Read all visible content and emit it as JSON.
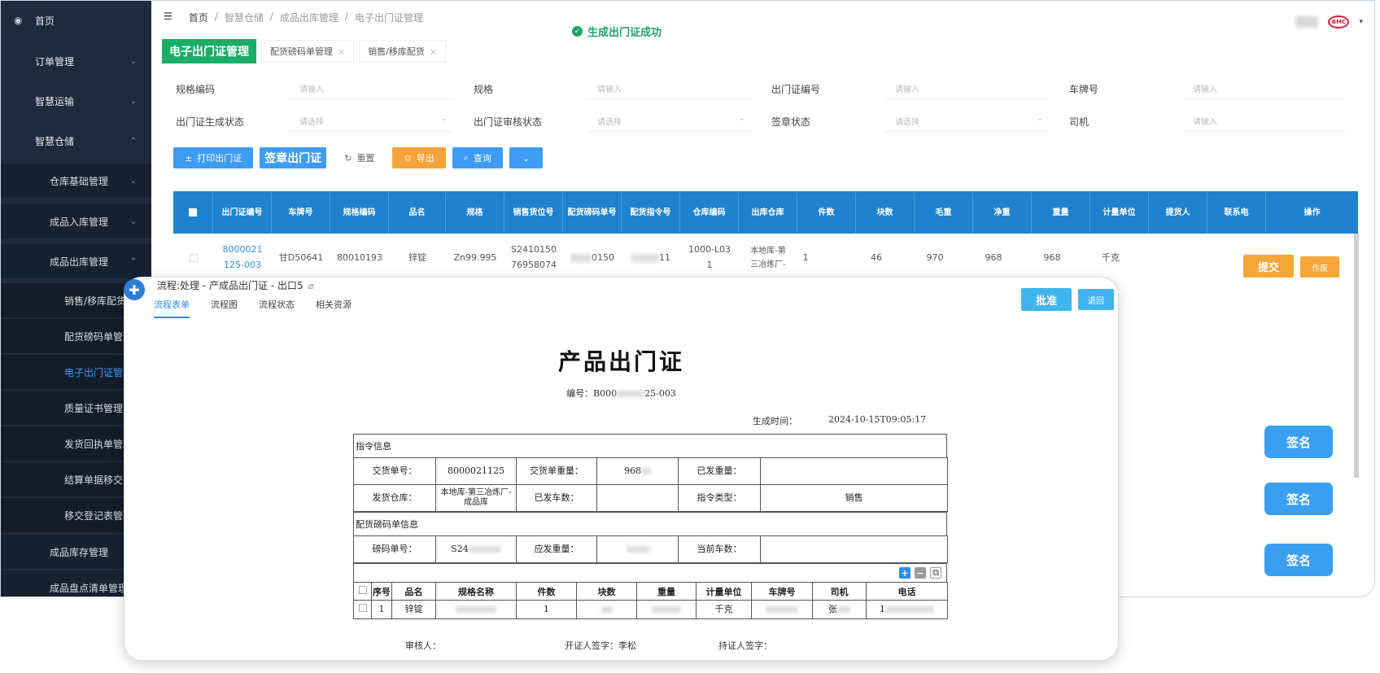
{
  "sidebar": {
    "items": [
      {
        "label": "首页",
        "level": 1,
        "expanded": false,
        "chevron": false
      },
      {
        "label": "订单管理",
        "level": 1,
        "chevron": "down"
      },
      {
        "label": "智慧运输",
        "level": 1,
        "chevron": "down"
      },
      {
        "label": "智慧仓储",
        "level": 1,
        "chevron": "up"
      },
      {
        "label": "仓库基础管理",
        "level": 2,
        "chevron": "down"
      },
      {
        "label": "成品入库管理",
        "level": 2,
        "chevron": "down"
      },
      {
        "label": "成品出库管理",
        "level": 2,
        "chevron": "up"
      },
      {
        "label": "销售/移库配货",
        "level": 3
      },
      {
        "label": "配货磅码单管理",
        "level": 3
      },
      {
        "label": "电子出门证管理",
        "level": 3,
        "active": true
      },
      {
        "label": "质量证书管理",
        "level": 3
      },
      {
        "label": "发货回执单管理",
        "level": 3
      },
      {
        "label": "结算单据移交",
        "level": 3
      },
      {
        "label": "移交登记表管理",
        "level": 3
      },
      {
        "label": "成品库存管理",
        "level": 2
      },
      {
        "label": "成品盘点清单管理",
        "level": 2
      }
    ]
  },
  "breadcrumb": [
    "首页",
    "智慧仓储",
    "成品出库管理",
    "电子出门证管理"
  ],
  "toast": "生成出门证成功",
  "tabs": [
    {
      "label": "电子出门证管理",
      "active": true
    },
    {
      "label": "配货磅码单管理",
      "close": "×"
    },
    {
      "label": "销售/移库配货",
      "close": "×"
    }
  ],
  "filters": {
    "spec_code_label": "规格编码",
    "spec_code_placeholder": "请输入",
    "spec_label": "规格",
    "spec_placeholder": "请输入",
    "permit_no_label": "出门证编号",
    "permit_no_placeholder": "请输入",
    "plate_label": "车牌号",
    "plate_placeholder": "请输入",
    "gen_status_label": "出门证生成状态",
    "gen_status_placeholder": "请选择",
    "audit_status_label": "出门证审核状态",
    "audit_status_placeholder": "请选择",
    "seal_status_label": "签章状态",
    "seal_status_placeholder": "请选择",
    "driver_label": "司机",
    "driver_placeholder": "请输入"
  },
  "actions": {
    "print": "打印出门证",
    "seal": "签章出门证",
    "reset": "重置",
    "export": "导出",
    "query": "查询"
  },
  "grid": {
    "headers": [
      "出门证编号",
      "车牌号",
      "规格编码",
      "品名",
      "规格",
      "销售货位号",
      "配货磅码单号",
      "配货指令号",
      "仓库编码",
      "出库仓库",
      "件数",
      "块数",
      "毛重",
      "净重",
      "重量",
      "计量单位",
      "提货人",
      "联系电",
      "操作"
    ],
    "row": {
      "permit_no_1": "8000021",
      "permit_no_2": "125-003",
      "plate": "甘D50641",
      "spec_code": "80010193",
      "product": "锌锭",
      "spec": "Zn99.995",
      "sales_loc_1": "S2410150",
      "sales_loc_2": "76958074",
      "bill_no": "0150",
      "instr_no": "11",
      "wh_code_1": "1000-L03",
      "wh_code_2": "1",
      "warehouse_1": "本地库-第",
      "warehouse_2": "三冶炼厂-",
      "pieces": "1",
      "blocks": "46",
      "gross": "970",
      "net": "968",
      "weight": "968",
      "unit": "千克"
    },
    "ops": {
      "submit": "提交",
      "void": "作废"
    }
  },
  "sign_buttons": [
    "签名",
    "签名",
    "签名"
  ],
  "modal": {
    "title": "流程:处理 - 产成品出门证 - 出口5",
    "tabs": [
      "流程表单",
      "流程图",
      "流程状态",
      "相关资源"
    ],
    "approve": "批准",
    "return": "退回",
    "doc_title": "产品出门证",
    "doc_no": "编号：B000",
    "doc_no_tail": "25-003",
    "gen_time_label": "生成时间：",
    "gen_time": "2024-10-15T09:05:17",
    "section1": "指令信息",
    "s1": {
      "delivery_no_label": "交货单号：",
      "delivery_no": "8000021125",
      "delivery_weight_label": "交货单重量：",
      "delivery_weight": "968",
      "shipped_weight_label": "已发重量：",
      "ship_wh_label": "发货仓库：",
      "ship_wh": "本地库-第三冶炼厂-成品库",
      "shipped_cars_label": "已发车数：",
      "instr_type_label": "指令类型：",
      "instr_type": "销售"
    },
    "section2": "配货磅码单信息",
    "s2": {
      "bill_no_label": "磅码单号：",
      "bill_no": "S24",
      "due_weight_label": "应发重量：",
      "current_cars_label": "当前车数："
    },
    "item_headers": [
      "序号",
      "品名",
      "规格名称",
      "件数",
      "块数",
      "重量",
      "计量单位",
      "车牌号",
      "司机",
      "电话"
    ],
    "item_row": {
      "seq": "1",
      "product": "锌锭",
      "pieces": "1",
      "unit": "千克",
      "driver": "张",
      "phone": "1"
    },
    "footer": {
      "auditor": "审核人：",
      "issuer": "开证人签字：李松",
      "holder": "持证人签字："
    }
  },
  "colors": {
    "sidebar_bg": "#1e2b3c",
    "grid_header": "#1e82d0",
    "success": "#21a366",
    "orange": "#f5a638",
    "blue": "#3a9ff0"
  }
}
